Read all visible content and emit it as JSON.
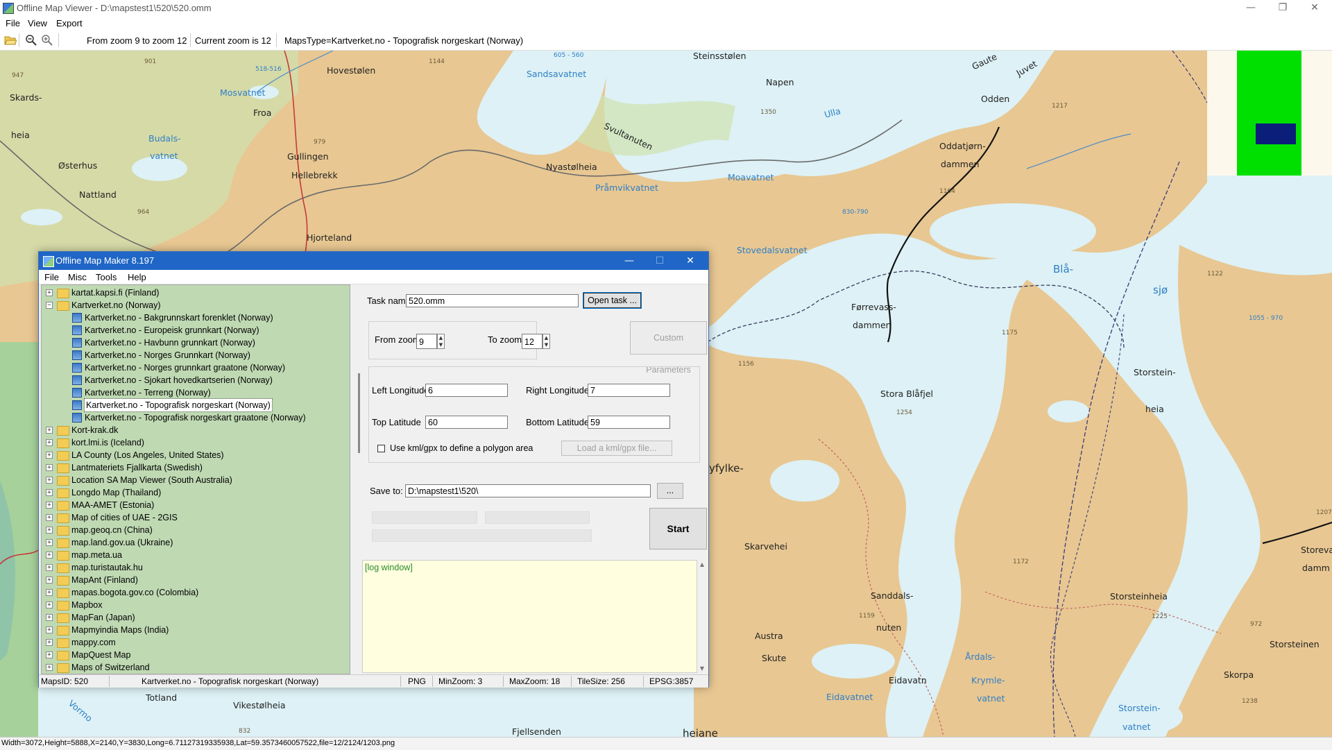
{
  "window": {
    "title": "Offline Map Viewer - D:\\mapstest1\\520\\520.omm",
    "controls": {
      "minimize": "—",
      "maximize": "❐",
      "close": "✕"
    }
  },
  "menu": [
    "File",
    "View",
    "Export"
  ],
  "toolbar": {
    "zoom_range": "From zoom 9 to zoom 12",
    "current_zoom": "Current zoom is 12",
    "maps_type": "MapsType=Kartverket.no - Topografisk norgeskart (Norway)"
  },
  "map": {
    "labels": [
      {
        "text": "Hovestølen",
        "cls": ""
      },
      {
        "text": "Skards-",
        "cls": ""
      },
      {
        "text": "heia",
        "cls": ""
      },
      {
        "text": "Mosvatnet",
        "cls": "water"
      },
      {
        "text": "Froa",
        "cls": ""
      },
      {
        "text": "Budals-",
        "cls": "water"
      },
      {
        "text": "vatnet",
        "cls": "water"
      },
      {
        "text": "Østerhus",
        "cls": ""
      },
      {
        "text": "Gullingen",
        "cls": ""
      },
      {
        "text": "Hellebrekk",
        "cls": ""
      },
      {
        "text": "Nattland",
        "cls": ""
      },
      {
        "text": "Hjorteland",
        "cls": ""
      },
      {
        "text": "Sandsavatnet",
        "cls": "water"
      },
      {
        "text": "Steinsstølen",
        "cls": ""
      },
      {
        "text": "Napen",
        "cls": ""
      },
      {
        "text": "Gaute",
        "cls": ""
      },
      {
        "text": "Juvet",
        "cls": ""
      },
      {
        "text": "Odden",
        "cls": ""
      },
      {
        "text": "Ulla",
        "cls": "water"
      },
      {
        "text": "Svultanuten",
        "cls": ""
      },
      {
        "text": "Nyastølheia",
        "cls": ""
      },
      {
        "text": "Pråmvikvatnet",
        "cls": "water"
      },
      {
        "text": "Moavatnet",
        "cls": "water"
      },
      {
        "text": "Oddatjørn-",
        "cls": ""
      },
      {
        "text": "dammen",
        "cls": ""
      },
      {
        "text": "Stovedalsvatnet",
        "cls": "water"
      },
      {
        "text": "Blå-",
        "cls": "water"
      },
      {
        "text": "sjø",
        "cls": "water"
      },
      {
        "text": "Førrevass-",
        "cls": ""
      },
      {
        "text": "dammen",
        "cls": ""
      },
      {
        "text": "Storstein-",
        "cls": ""
      },
      {
        "text": "heia",
        "cls": ""
      },
      {
        "text": "Stora Blåfjel",
        "cls": ""
      },
      {
        "text": "yfylke-",
        "cls": ""
      },
      {
        "text": "Skarvehei",
        "cls": ""
      },
      {
        "text": "Sanddals-",
        "cls": ""
      },
      {
        "text": "nuten",
        "cls": ""
      },
      {
        "text": "Austra",
        "cls": ""
      },
      {
        "text": "Skute",
        "cls": ""
      },
      {
        "text": "Eidavatn",
        "cls": ""
      },
      {
        "text": "Eidavatnet",
        "cls": "water"
      },
      {
        "text": "Årdals-",
        "cls": "water"
      },
      {
        "text": "Krymle-",
        "cls": "water"
      },
      {
        "text": "vatnet",
        "cls": "water"
      },
      {
        "text": "Storsteinheia",
        "cls": ""
      },
      {
        "text": "Storsteinen",
        "cls": ""
      },
      {
        "text": "Skorpa",
        "cls": ""
      },
      {
        "text": "Storstein-",
        "cls": "water"
      },
      {
        "text": "vatnet",
        "cls": "water"
      },
      {
        "text": "Storeva",
        "cls": ""
      },
      {
        "text": "damm",
        "cls": ""
      },
      {
        "text": "Totland",
        "cls": ""
      },
      {
        "text": "Vikestølheia",
        "cls": ""
      },
      {
        "text": "Fjellsenden",
        "cls": ""
      },
      {
        "text": "heiane",
        "cls": ""
      },
      {
        "text": "Vormo",
        "cls": "water"
      }
    ],
    "heights": [
      "901",
      "947",
      "1144",
      "979",
      "964",
      "1350",
      "1217",
      "1164",
      "1156",
      "1175",
      "1122",
      "1254",
      "1172",
      "1159",
      "1225",
      "972",
      "1238",
      "1207",
      "832",
      "605 - 560",
      "518-516",
      "830-790",
      "1055 - 970"
    ]
  },
  "minimap": {
    "colors": {
      "background": "#fdf8ec",
      "coverage": "#00e000",
      "viewport": "#0a1e7a"
    }
  },
  "status": "Width=3072,Height=5888,X=2140,Y=3830,Long=6.71127319335938,Lat=59.3573460057522,file=12/2124/1203.png",
  "dialog": {
    "title": "Offline Map Maker 8.197",
    "controls": {
      "minimize": "—",
      "maximize": "☐",
      "close": "✕"
    },
    "menu": [
      "File",
      "Misc",
      "Tools",
      "Help"
    ],
    "tree": [
      {
        "label": "kartat.kapsi.fi (Finland)",
        "level": 0,
        "type": "folder",
        "expander": "+",
        "selected": false
      },
      {
        "label": "Kartverket.no (Norway)",
        "level": 0,
        "type": "folder-open",
        "expander": "−",
        "selected": false
      },
      {
        "label": "Kartverket.no - Bakgrunnskart forenklet (Norway)",
        "level": 1,
        "type": "map",
        "expander": "",
        "selected": false
      },
      {
        "label": "Kartverket.no - Europeisk grunnkart (Norway)",
        "level": 1,
        "type": "map",
        "expander": "",
        "selected": false
      },
      {
        "label": "Kartverket.no - Havbunn grunnkart (Norway)",
        "level": 1,
        "type": "map",
        "expander": "",
        "selected": false
      },
      {
        "label": "Kartverket.no - Norges Grunnkart (Norway)",
        "level": 1,
        "type": "map",
        "expander": "",
        "selected": false
      },
      {
        "label": "Kartverket.no - Norges grunnkart graatone (Norway)",
        "level": 1,
        "type": "map",
        "expander": "",
        "selected": false
      },
      {
        "label": "Kartverket.no - Sjokart hovedkartserien (Norway)",
        "level": 1,
        "type": "map",
        "expander": "",
        "selected": false
      },
      {
        "label": "Kartverket.no - Terreng (Norway)",
        "level": 1,
        "type": "map",
        "expander": "",
        "selected": false
      },
      {
        "label": "Kartverket.no - Topografisk norgeskart (Norway)",
        "level": 1,
        "type": "map",
        "expander": "",
        "selected": true
      },
      {
        "label": "Kartverket.no - Topografisk norgeskart graatone (Norway)",
        "level": 1,
        "type": "map",
        "expander": "",
        "selected": false
      },
      {
        "label": "Kort-krak.dk",
        "level": 0,
        "type": "folder",
        "expander": "+",
        "selected": false
      },
      {
        "label": "kort.lmi.is (Iceland)",
        "level": 0,
        "type": "folder",
        "expander": "+",
        "selected": false
      },
      {
        "label": "LA County (Los Angeles, United States)",
        "level": 0,
        "type": "folder",
        "expander": "+",
        "selected": false
      },
      {
        "label": "Lantmateriets Fjallkarta (Swedish)",
        "level": 0,
        "type": "folder",
        "expander": "+",
        "selected": false
      },
      {
        "label": "Location SA Map Viewer (South Australia)",
        "level": 0,
        "type": "folder",
        "expander": "+",
        "selected": false
      },
      {
        "label": "Longdo Map (Thailand)",
        "level": 0,
        "type": "folder",
        "expander": "+",
        "selected": false
      },
      {
        "label": "MAA-AMET (Estonia)",
        "level": 0,
        "type": "folder",
        "expander": "+",
        "selected": false
      },
      {
        "label": "Map of cities of UAE - 2GIS",
        "level": 0,
        "type": "folder",
        "expander": "+",
        "selected": false
      },
      {
        "label": "map.geoq.cn (China)",
        "level": 0,
        "type": "folder",
        "expander": "+",
        "selected": false
      },
      {
        "label": "map.land.gov.ua (Ukraine)",
        "level": 0,
        "type": "folder",
        "expander": "+",
        "selected": false
      },
      {
        "label": "map.meta.ua",
        "level": 0,
        "type": "folder",
        "expander": "+",
        "selected": false
      },
      {
        "label": "map.turistautak.hu",
        "level": 0,
        "type": "folder",
        "expander": "+",
        "selected": false
      },
      {
        "label": "MapAnt (Finland)",
        "level": 0,
        "type": "folder",
        "expander": "+",
        "selected": false
      },
      {
        "label": "mapas.bogota.gov.co (Colombia)",
        "level": 0,
        "type": "folder",
        "expander": "+",
        "selected": false
      },
      {
        "label": "Mapbox",
        "level": 0,
        "type": "folder",
        "expander": "+",
        "selected": false
      },
      {
        "label": "MapFan (Japan)",
        "level": 0,
        "type": "folder",
        "expander": "+",
        "selected": false
      },
      {
        "label": "Mapmyindia Maps (India)",
        "level": 0,
        "type": "folder",
        "expander": "+",
        "selected": false
      },
      {
        "label": "mappy.com",
        "level": 0,
        "type": "folder",
        "expander": "+",
        "selected": false
      },
      {
        "label": "MapQuest Map",
        "level": 0,
        "type": "folder",
        "expander": "+",
        "selected": false
      },
      {
        "label": "Maps of Switzerland",
        "level": 0,
        "type": "folder",
        "expander": "+",
        "selected": false
      }
    ],
    "task_name_label": "Task name",
    "task_name_value": "520.omm",
    "open_task_button": "Open task ...",
    "from_zoom_label": "From zoom",
    "from_zoom_value": "9",
    "to_zoom_label": "To zoom",
    "to_zoom_value": "12",
    "custom_params_button": "Custom Parameters",
    "left_lon_label": "Left Longitude",
    "left_lon_value": "6",
    "right_lon_label": "Right Longitude",
    "right_lon_value": "7",
    "top_lat_label": "Top Latitude",
    "top_lat_value": "60",
    "bottom_lat_label": "Bottom Latitude",
    "bottom_lat_value": "59",
    "kml_checkbox_label": "Use kml/gpx to define a polygon area",
    "kml_checked": false,
    "load_kml_button": "Load a kml/gpx file...",
    "save_to_label": "Save to:",
    "save_to_value": "D:\\mapstest1\\520\\",
    "browse_button": "...",
    "start_button": "Start",
    "log_text": "[log window]",
    "status": [
      "MapsID: 520",
      "Kartverket.no - Topografisk norgeskart (Norway)",
      "PNG",
      "MinZoom: 3",
      "MaxZoom: 18",
      "TileSize: 256",
      "EPSG:3857"
    ]
  }
}
